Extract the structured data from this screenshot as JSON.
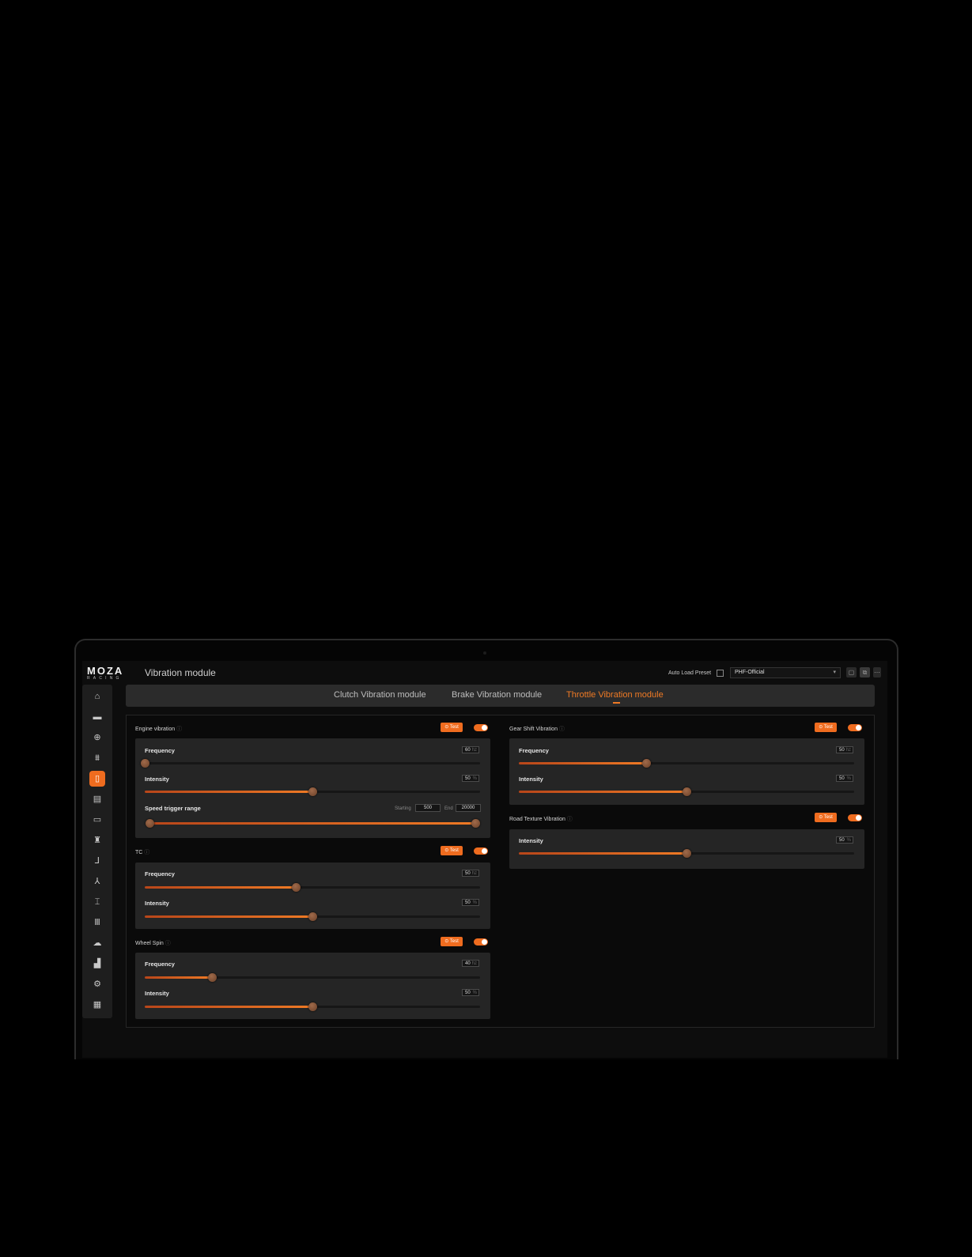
{
  "header": {
    "brand": "MOZA",
    "brand_sub": "RACING",
    "page_title": "Vibration module",
    "auto_load_label": "Auto Load Preset",
    "preset_value": "PHF-Official"
  },
  "sidebar": {
    "items": [
      {
        "icon": "home-icon",
        "glyph": "⌂"
      },
      {
        "icon": "wheelbase-icon",
        "glyph": "▬"
      },
      {
        "icon": "steering-wheel-icon",
        "glyph": "⊕"
      },
      {
        "icon": "dashboard-icon",
        "glyph": "⩩"
      },
      {
        "icon": "pedal-icon",
        "glyph": "▯"
      },
      {
        "icon": "display-icon",
        "glyph": "▤"
      },
      {
        "icon": "handbrake-icon",
        "glyph": "▭"
      },
      {
        "icon": "shifter-icon",
        "glyph": "♜"
      },
      {
        "icon": "lever-icon",
        "glyph": "⅃"
      },
      {
        "icon": "sequential-icon",
        "glyph": "⅄"
      },
      {
        "icon": "wheel-hub-icon",
        "glyph": "⌶"
      },
      {
        "icon": "library-icon",
        "glyph": "Ⅲ"
      },
      {
        "icon": "cloud-icon",
        "glyph": "☁"
      },
      {
        "icon": "stand-icon",
        "glyph": "▟"
      },
      {
        "icon": "settings-icon",
        "glyph": "⚙"
      },
      {
        "icon": "firmware-icon",
        "glyph": "▦"
      }
    ],
    "active_index": 4
  },
  "tabs": [
    {
      "label": "Clutch Vibration module"
    },
    {
      "label": "Brake Vibration module"
    },
    {
      "label": "Throttle Vibration module"
    }
  ],
  "active_tab": 2,
  "accent_color": "#ef6c1f",
  "test_label": "Test",
  "sections": {
    "engine": {
      "title": "Engine vibration",
      "frequency": {
        "label": "Frequency",
        "value": "60",
        "unit": "hz",
        "level": 0.0
      },
      "intensity": {
        "label": "Intensity",
        "value": "50",
        "unit": "%",
        "level": 0.5
      },
      "speed": {
        "label": "Speed trigger range",
        "start_label": "Starting",
        "start": "500",
        "end_label": "End",
        "end": "20000",
        "level_start": 0.0,
        "level_end": 1.0
      }
    },
    "tc": {
      "title": "TC",
      "frequency": {
        "label": "Frequency",
        "value": "50",
        "unit": "hz",
        "level": 0.45
      },
      "intensity": {
        "label": "Intensity",
        "value": "50",
        "unit": "%",
        "level": 0.5
      }
    },
    "wheelspin": {
      "title": "Wheel Spin",
      "frequency": {
        "label": "Frequency",
        "value": "40",
        "unit": "hz",
        "level": 0.2
      },
      "intensity": {
        "label": "Intensity",
        "value": "50",
        "unit": "%",
        "level": 0.5
      }
    },
    "gearshift": {
      "title": "Gear Shift Vibration",
      "frequency": {
        "label": "Frequency",
        "value": "50",
        "unit": "hz",
        "level": 0.38
      },
      "intensity": {
        "label": "Intensity",
        "value": "50",
        "unit": "%",
        "level": 0.5
      }
    },
    "road": {
      "title": "Road Texture Vibration",
      "intensity": {
        "label": "Intensity",
        "value": "50",
        "unit": "%",
        "level": 0.5
      }
    }
  }
}
